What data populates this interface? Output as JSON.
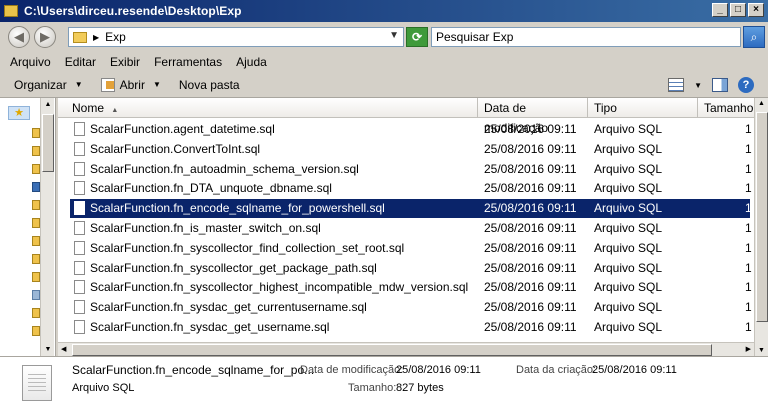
{
  "window": {
    "title": "C:\\Users\\dirceu.resende\\Desktop\\Exp",
    "buttons": [
      "_",
      "□",
      "×"
    ]
  },
  "address": {
    "path": "Exp",
    "search_placeholder": "Pesquisar Exp"
  },
  "menu": [
    "Arquivo",
    "Editar",
    "Exibir",
    "Ferramentas",
    "Ajuda"
  ],
  "toolbar": {
    "organize": "Organizar",
    "open": "Abrir",
    "new_folder": "Nova pasta"
  },
  "columns": {
    "name": "Nome",
    "modified": "Data de modificação",
    "type": "Tipo",
    "size": "Tamanho"
  },
  "files": [
    {
      "name": "ScalarFunction.agent_datetime.sql",
      "modified": "25/08/2016 09:11",
      "type": "Arquivo SQL",
      "size": "1"
    },
    {
      "name": "ScalarFunction.ConvertToInt.sql",
      "modified": "25/08/2016 09:11",
      "type": "Arquivo SQL",
      "size": "1"
    },
    {
      "name": "ScalarFunction.fn_autoadmin_schema_version.sql",
      "modified": "25/08/2016 09:11",
      "type": "Arquivo SQL",
      "size": "1"
    },
    {
      "name": "ScalarFunction.fn_DTA_unquote_dbname.sql",
      "modified": "25/08/2016 09:11",
      "type": "Arquivo SQL",
      "size": "1"
    },
    {
      "name": "ScalarFunction.fn_encode_sqlname_for_powershell.sql",
      "modified": "25/08/2016 09:11",
      "type": "Arquivo SQL",
      "size": "1",
      "selected": true
    },
    {
      "name": "ScalarFunction.fn_is_master_switch_on.sql",
      "modified": "25/08/2016 09:11",
      "type": "Arquivo SQL",
      "size": "1"
    },
    {
      "name": "ScalarFunction.fn_syscollector_find_collection_set_root.sql",
      "modified": "25/08/2016 09:11",
      "type": "Arquivo SQL",
      "size": "1"
    },
    {
      "name": "ScalarFunction.fn_syscollector_get_package_path.sql",
      "modified": "25/08/2016 09:11",
      "type": "Arquivo SQL",
      "size": "1"
    },
    {
      "name": "ScalarFunction.fn_syscollector_highest_incompatible_mdw_version.sql",
      "modified": "25/08/2016 09:11",
      "type": "Arquivo SQL",
      "size": "1"
    },
    {
      "name": "ScalarFunction.fn_sysdac_get_currentusername.sql",
      "modified": "25/08/2016 09:11",
      "type": "Arquivo SQL",
      "size": "1"
    },
    {
      "name": "ScalarFunction.fn_sysdac_get_username.sql",
      "modified": "25/08/2016 09:11",
      "type": "Arquivo SQL",
      "size": "1"
    }
  ],
  "details": {
    "name": "ScalarFunction.fn_encode_sqlname_for_po...",
    "type": "Arquivo SQL",
    "modified_label": "Data de modificação:",
    "modified_value": "25/08/2016 09:11",
    "created_label": "Data da criação:",
    "created_value": "25/08/2016 09:11",
    "size_label": "Tamanho:",
    "size_value": "827 bytes"
  },
  "colors": {
    "selection": "#0a246a",
    "title_bar": "#0a246a"
  }
}
